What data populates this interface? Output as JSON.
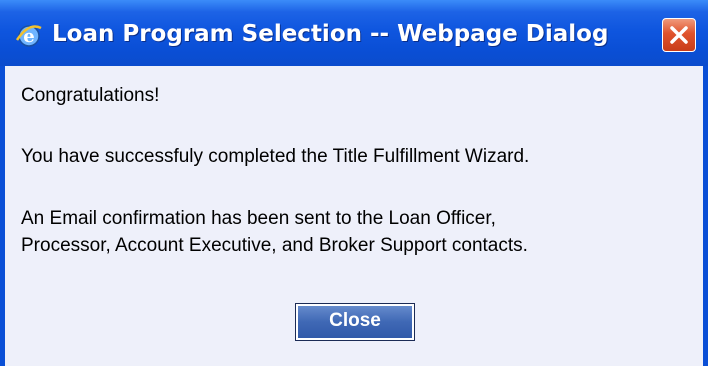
{
  "window": {
    "title": "Loan Program Selection -- Webpage Dialog",
    "title_icon": "ie-icon",
    "close_icon": "close-icon"
  },
  "message": {
    "line1": "Congratulations!",
    "line2": "You have successfuly completed the Title Fulfillment Wizard.",
    "line3": "An Email confirmation has been sent to the Loan Officer,",
    "line4": "Processor, Account Executive, and Broker Support contacts."
  },
  "actions": {
    "close_label": "Close"
  },
  "colors": {
    "titlebar": "#0a4fd6",
    "client_background": "#eef0fa",
    "close_x": "#e0532c",
    "button": "#3f68b5"
  }
}
